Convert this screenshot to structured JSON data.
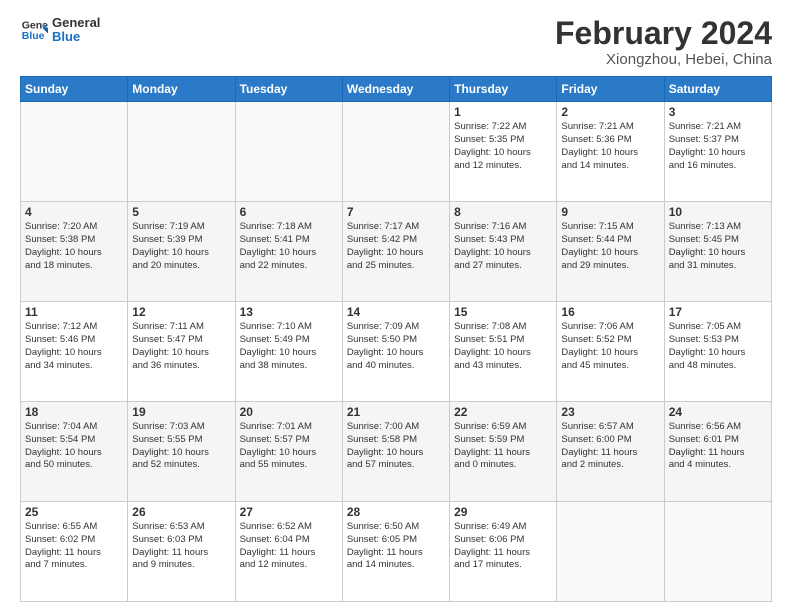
{
  "header": {
    "logo_line1": "General",
    "logo_line2": "Blue",
    "title": "February 2024",
    "subtitle": "Xiongzhou, Hebei, China"
  },
  "days_of_week": [
    "Sunday",
    "Monday",
    "Tuesday",
    "Wednesday",
    "Thursday",
    "Friday",
    "Saturday"
  ],
  "weeks": [
    [
      {
        "day": "",
        "info": ""
      },
      {
        "day": "",
        "info": ""
      },
      {
        "day": "",
        "info": ""
      },
      {
        "day": "",
        "info": ""
      },
      {
        "day": "1",
        "info": "Sunrise: 7:22 AM\nSunset: 5:35 PM\nDaylight: 10 hours\nand 12 minutes."
      },
      {
        "day": "2",
        "info": "Sunrise: 7:21 AM\nSunset: 5:36 PM\nDaylight: 10 hours\nand 14 minutes."
      },
      {
        "day": "3",
        "info": "Sunrise: 7:21 AM\nSunset: 5:37 PM\nDaylight: 10 hours\nand 16 minutes."
      }
    ],
    [
      {
        "day": "4",
        "info": "Sunrise: 7:20 AM\nSunset: 5:38 PM\nDaylight: 10 hours\nand 18 minutes."
      },
      {
        "day": "5",
        "info": "Sunrise: 7:19 AM\nSunset: 5:39 PM\nDaylight: 10 hours\nand 20 minutes."
      },
      {
        "day": "6",
        "info": "Sunrise: 7:18 AM\nSunset: 5:41 PM\nDaylight: 10 hours\nand 22 minutes."
      },
      {
        "day": "7",
        "info": "Sunrise: 7:17 AM\nSunset: 5:42 PM\nDaylight: 10 hours\nand 25 minutes."
      },
      {
        "day": "8",
        "info": "Sunrise: 7:16 AM\nSunset: 5:43 PM\nDaylight: 10 hours\nand 27 minutes."
      },
      {
        "day": "9",
        "info": "Sunrise: 7:15 AM\nSunset: 5:44 PM\nDaylight: 10 hours\nand 29 minutes."
      },
      {
        "day": "10",
        "info": "Sunrise: 7:13 AM\nSunset: 5:45 PM\nDaylight: 10 hours\nand 31 minutes."
      }
    ],
    [
      {
        "day": "11",
        "info": "Sunrise: 7:12 AM\nSunset: 5:46 PM\nDaylight: 10 hours\nand 34 minutes."
      },
      {
        "day": "12",
        "info": "Sunrise: 7:11 AM\nSunset: 5:47 PM\nDaylight: 10 hours\nand 36 minutes."
      },
      {
        "day": "13",
        "info": "Sunrise: 7:10 AM\nSunset: 5:49 PM\nDaylight: 10 hours\nand 38 minutes."
      },
      {
        "day": "14",
        "info": "Sunrise: 7:09 AM\nSunset: 5:50 PM\nDaylight: 10 hours\nand 40 minutes."
      },
      {
        "day": "15",
        "info": "Sunrise: 7:08 AM\nSunset: 5:51 PM\nDaylight: 10 hours\nand 43 minutes."
      },
      {
        "day": "16",
        "info": "Sunrise: 7:06 AM\nSunset: 5:52 PM\nDaylight: 10 hours\nand 45 minutes."
      },
      {
        "day": "17",
        "info": "Sunrise: 7:05 AM\nSunset: 5:53 PM\nDaylight: 10 hours\nand 48 minutes."
      }
    ],
    [
      {
        "day": "18",
        "info": "Sunrise: 7:04 AM\nSunset: 5:54 PM\nDaylight: 10 hours\nand 50 minutes."
      },
      {
        "day": "19",
        "info": "Sunrise: 7:03 AM\nSunset: 5:55 PM\nDaylight: 10 hours\nand 52 minutes."
      },
      {
        "day": "20",
        "info": "Sunrise: 7:01 AM\nSunset: 5:57 PM\nDaylight: 10 hours\nand 55 minutes."
      },
      {
        "day": "21",
        "info": "Sunrise: 7:00 AM\nSunset: 5:58 PM\nDaylight: 10 hours\nand 57 minutes."
      },
      {
        "day": "22",
        "info": "Sunrise: 6:59 AM\nSunset: 5:59 PM\nDaylight: 11 hours\nand 0 minutes."
      },
      {
        "day": "23",
        "info": "Sunrise: 6:57 AM\nSunset: 6:00 PM\nDaylight: 11 hours\nand 2 minutes."
      },
      {
        "day": "24",
        "info": "Sunrise: 6:56 AM\nSunset: 6:01 PM\nDaylight: 11 hours\nand 4 minutes."
      }
    ],
    [
      {
        "day": "25",
        "info": "Sunrise: 6:55 AM\nSunset: 6:02 PM\nDaylight: 11 hours\nand 7 minutes."
      },
      {
        "day": "26",
        "info": "Sunrise: 6:53 AM\nSunset: 6:03 PM\nDaylight: 11 hours\nand 9 minutes."
      },
      {
        "day": "27",
        "info": "Sunrise: 6:52 AM\nSunset: 6:04 PM\nDaylight: 11 hours\nand 12 minutes."
      },
      {
        "day": "28",
        "info": "Sunrise: 6:50 AM\nSunset: 6:05 PM\nDaylight: 11 hours\nand 14 minutes."
      },
      {
        "day": "29",
        "info": "Sunrise: 6:49 AM\nSunset: 6:06 PM\nDaylight: 11 hours\nand 17 minutes."
      },
      {
        "day": "",
        "info": ""
      },
      {
        "day": "",
        "info": ""
      }
    ]
  ]
}
